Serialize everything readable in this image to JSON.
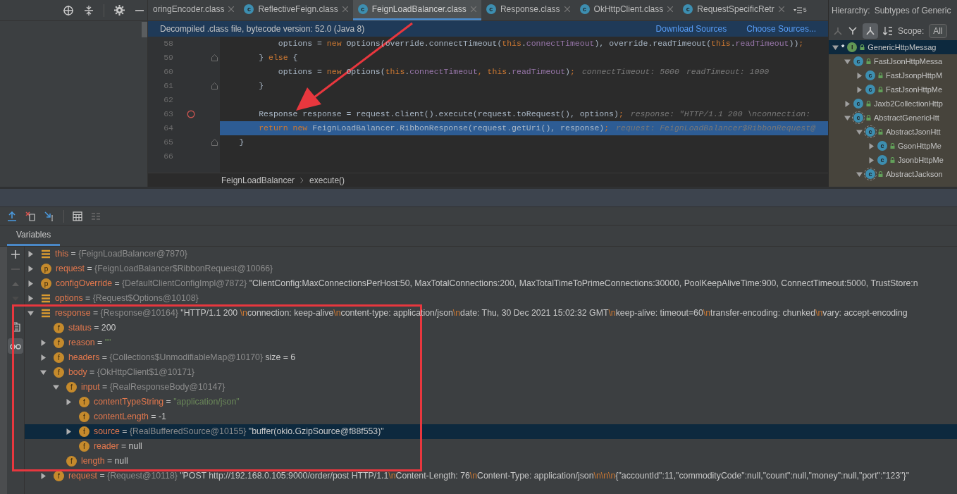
{
  "editor_tabs": [
    {
      "label": "oringEncoder.class",
      "selected": false
    },
    {
      "label": "ReflectiveFeign.class",
      "badge": "c",
      "selected": false
    },
    {
      "label": "FeignLoadBalancer.class",
      "badge": "c",
      "selected": true
    },
    {
      "label": "Response.class",
      "badge": "c",
      "selected": false
    },
    {
      "label": "OkHttpClient.class",
      "badge": "c",
      "selected": false
    },
    {
      "label": "RequestSpecificRetr",
      "badge": "c",
      "selected": false
    }
  ],
  "tab_overflow": "5",
  "banner": {
    "text": "Decompiled .class file, bytecode version: 52.0 (Java 8)",
    "links": [
      "Download Sources",
      "Choose Sources..."
    ]
  },
  "code_lines": [
    {
      "number": "58",
      "breakpoint": false,
      "current": false,
      "fold": false,
      "segments": [
        {
          "kind": "plain",
          "text": "            options = "
        },
        {
          "kind": "keyword",
          "text": "new"
        },
        {
          "kind": "plain",
          "text": " Options(override.connectTimeout("
        },
        {
          "kind": "keyword",
          "text": "this"
        },
        {
          "kind": "plain",
          "text": "."
        },
        {
          "kind": "field",
          "text": "connectTimeout"
        },
        {
          "kind": "plain",
          "text": "), override.readTimeout("
        },
        {
          "kind": "keyword",
          "text": "this"
        },
        {
          "kind": "plain",
          "text": "."
        },
        {
          "kind": "field",
          "text": "readTimeout"
        },
        {
          "kind": "plain",
          "text": "))"
        },
        {
          "kind": "keyword",
          "text": ";"
        }
      ]
    },
    {
      "number": "59",
      "breakpoint": false,
      "current": false,
      "fold": true,
      "segments": [
        {
          "kind": "plain",
          "text": "        } "
        },
        {
          "kind": "keyword",
          "text": "else"
        },
        {
          "kind": "plain",
          "text": " {"
        }
      ]
    },
    {
      "number": "60",
      "breakpoint": false,
      "current": false,
      "fold": false,
      "segments": [
        {
          "kind": "plain",
          "text": "            options = "
        },
        {
          "kind": "keyword",
          "text": "new"
        },
        {
          "kind": "plain",
          "text": " Options("
        },
        {
          "kind": "keyword",
          "text": "this"
        },
        {
          "kind": "plain",
          "text": "."
        },
        {
          "kind": "field",
          "text": "connectTimeout"
        },
        {
          "kind": "keyword",
          "text": ", this"
        },
        {
          "kind": "plain",
          "text": "."
        },
        {
          "kind": "field",
          "text": "readTimeout"
        },
        {
          "kind": "plain",
          "text": ")"
        },
        {
          "kind": "keyword",
          "text": ";"
        },
        {
          "kind": "hint",
          "text": "connectTimeout: 5000"
        },
        {
          "kind": "hint",
          "text": "readTimeout: 1000"
        }
      ]
    },
    {
      "number": "61",
      "breakpoint": false,
      "current": false,
      "fold": true,
      "segments": [
        {
          "kind": "plain",
          "text": "        }"
        }
      ]
    },
    {
      "number": "62",
      "breakpoint": false,
      "current": false,
      "fold": false
    },
    {
      "number": "63",
      "breakpoint": true,
      "current": false,
      "fold": false,
      "segments": [
        {
          "kind": "plain",
          "text": "        Response response = request.client().execute(request.toRequest(), options)"
        },
        {
          "kind": "keyword",
          "text": ";"
        },
        {
          "kind": "hint",
          "text": "response: \"HTTP/1.1 200 \\nconnection: "
        }
      ]
    },
    {
      "number": "64",
      "breakpoint": false,
      "current": true,
      "fold": false,
      "segments": [
        {
          "kind": "keyword",
          "text": "        return new"
        },
        {
          "kind": "plain",
          "text": " FeignLoadBalancer.RibbonResponse(request.getUri(), response)"
        },
        {
          "kind": "keyword",
          "text": ";"
        },
        {
          "kind": "hint",
          "text": "request: FeignLoadBalancer$RibbonRequest@"
        }
      ]
    },
    {
      "number": "65",
      "breakpoint": false,
      "current": false,
      "fold": true,
      "segments": [
        {
          "kind": "plain",
          "text": "    }"
        }
      ]
    },
    {
      "number": "66",
      "breakpoint": false,
      "current": false,
      "fold": false
    }
  ],
  "breadcrumb": [
    "FeignLoadBalancer",
    "execute()"
  ],
  "hierarchy": {
    "title": "Hierarchy:",
    "subtitle": "Subtypes of Generic",
    "scope_label": "Scope:",
    "scope_value": "All",
    "tree": [
      {
        "marker": "*",
        "kind": "interface",
        "badge": "I",
        "name": "GenericHttpMessag",
        "expanded": true,
        "selected": true,
        "children": [
          {
            "kind": "class",
            "badge": "c",
            "name": "FastJsonHttpMessa",
            "expanded": true,
            "selected": false,
            "children": [
              {
                "kind": "class",
                "badge": "c",
                "name": "FastJsonpHttpM",
                "expanded": false,
                "selected": false
              },
              {
                "kind": "class",
                "badge": "c",
                "name": "FastJsonHttpMe",
                "expanded": false,
                "selected": false
              }
            ]
          },
          {
            "kind": "class",
            "badge": "c",
            "name": "Jaxb2CollectionHttp",
            "expanded": false,
            "selected": false
          },
          {
            "kind": "abstract",
            "badge": "c",
            "name": "AbstractGenericHtt",
            "expanded": true,
            "selected": false,
            "children": [
              {
                "kind": "abstract",
                "badge": "c",
                "name": "AbstractJsonHtt",
                "expanded": true,
                "selected": false,
                "children": [
                  {
                    "kind": "class",
                    "badge": "c",
                    "name": "GsonHttpMe",
                    "expanded": false,
                    "selected": false
                  },
                  {
                    "kind": "class",
                    "badge": "c",
                    "name": "JsonbHttpMe",
                    "expanded": false,
                    "selected": false
                  }
                ]
              },
              {
                "kind": "abstract",
                "badge": "c",
                "name": "AbstractJackson",
                "expanded": true,
                "selected": false
              }
            ]
          }
        ]
      }
    ]
  },
  "debugger": {
    "tab": "Variables",
    "variables": [
      {
        "kind": "local",
        "expanded": false,
        "selected": false,
        "segments": [
          {
            "kind": "name",
            "text": "this"
          },
          {
            "kind": "text",
            "text": " = "
          },
          {
            "kind": "ref",
            "text": "{FeignLoadBalancer@7870}"
          }
        ]
      },
      {
        "kind": "badge",
        "badge": "p",
        "expanded": false,
        "selected": false,
        "segments": [
          {
            "kind": "name",
            "text": "request"
          },
          {
            "kind": "text",
            "text": " = "
          },
          {
            "kind": "ref",
            "text": "{FeignLoadBalancer$RibbonRequest@10066}"
          }
        ]
      },
      {
        "kind": "badge",
        "badge": "p",
        "expanded": false,
        "selected": false,
        "segments": [
          {
            "kind": "name",
            "text": "configOverride"
          },
          {
            "kind": "text",
            "text": " = "
          },
          {
            "kind": "ref",
            "text": "{DefaultClientConfigImpl@7872}"
          },
          {
            "kind": "text",
            "text": " \"ClientConfig:MaxConnectionsPerHost:50, MaxTotalConnections:200, MaxTotalTimeToPrimeConnections:30000, PoolKeepAliveTime:900, ConnectTimeout:5000, TrustStore:n"
          }
        ]
      },
      {
        "kind": "local",
        "expanded": false,
        "selected": false,
        "segments": [
          {
            "kind": "name",
            "text": "options"
          },
          {
            "kind": "text",
            "text": " = "
          },
          {
            "kind": "ref",
            "text": "{Request$Options@10108}"
          }
        ]
      },
      {
        "kind": "local",
        "expanded": true,
        "selected": false,
        "segments": [
          {
            "kind": "name",
            "text": "response"
          },
          {
            "kind": "text",
            "text": " = "
          },
          {
            "kind": "ref",
            "text": "{Response@10164}"
          },
          {
            "kind": "text",
            "text": " \"HTTP/1.1 200 "
          },
          {
            "kind": "escape",
            "text": "\\n"
          },
          {
            "kind": "text",
            "text": "connection: keep-alive"
          },
          {
            "kind": "escape",
            "text": "\\n"
          },
          {
            "kind": "text",
            "text": "content-type: application/json"
          },
          {
            "kind": "escape",
            "text": "\\n"
          },
          {
            "kind": "text",
            "text": "date: Thu, 30 Dec 2021 15:02:32 GMT"
          },
          {
            "kind": "escape",
            "text": "\\n"
          },
          {
            "kind": "text",
            "text": "keep-alive: timeout=60"
          },
          {
            "kind": "escape",
            "text": "\\n"
          },
          {
            "kind": "text",
            "text": "transfer-encoding: chunked"
          },
          {
            "kind": "escape",
            "text": "\\n"
          },
          {
            "kind": "text",
            "text": "vary: accept-encoding"
          }
        ],
        "children": [
          {
            "kind": "badge",
            "badge": "f",
            "selected": false,
            "segments": [
              {
                "kind": "name",
                "text": "status"
              },
              {
                "kind": "text",
                "text": " = 200"
              }
            ]
          },
          {
            "kind": "badge",
            "badge": "f",
            "expanded": false,
            "selected": false,
            "segments": [
              {
                "kind": "name",
                "text": "reason"
              },
              {
                "kind": "text",
                "text": " = "
              },
              {
                "kind": "string",
                "text": "\"\""
              }
            ]
          },
          {
            "kind": "badge",
            "badge": "f",
            "expanded": false,
            "selected": false,
            "segments": [
              {
                "kind": "name",
                "text": "headers"
              },
              {
                "kind": "text",
                "text": " = "
              },
              {
                "kind": "ref",
                "text": "{Collections$UnmodifiableMap@10170}"
              },
              {
                "kind": "text",
                "text": "  size = 6"
              }
            ]
          },
          {
            "kind": "badge",
            "badge": "f",
            "expanded": true,
            "selected": false,
            "segments": [
              {
                "kind": "name",
                "text": "body"
              },
              {
                "kind": "text",
                "text": " = "
              },
              {
                "kind": "ref",
                "text": "{OkHttpClient$1@10171}"
              }
            ],
            "children": [
              {
                "kind": "badge",
                "badge": "f",
                "expanded": true,
                "selected": false,
                "segments": [
                  {
                    "kind": "name",
                    "text": "input"
                  },
                  {
                    "kind": "text",
                    "text": " = "
                  },
                  {
                    "kind": "ref",
                    "text": "{RealResponseBody@10147}"
                  }
                ],
                "children": [
                  {
                    "kind": "badge",
                    "badge": "f",
                    "expanded": false,
                    "selected": false,
                    "segments": [
                      {
                        "kind": "name",
                        "text": "contentTypeString"
                      },
                      {
                        "kind": "text",
                        "text": " = "
                      },
                      {
                        "kind": "string",
                        "text": "\"application/json\""
                      }
                    ]
                  },
                  {
                    "kind": "badge",
                    "badge": "f",
                    "selected": false,
                    "segments": [
                      {
                        "kind": "name",
                        "text": "contentLength"
                      },
                      {
                        "kind": "text",
                        "text": " = -1"
                      }
                    ]
                  },
                  {
                    "kind": "badge",
                    "badge": "f",
                    "expanded": false,
                    "selected": true,
                    "segments": [
                      {
                        "kind": "name",
                        "text": "source"
                      },
                      {
                        "kind": "text",
                        "text": " = "
                      },
                      {
                        "kind": "ref",
                        "text": "{RealBufferedSource@10155}"
                      },
                      {
                        "kind": "text",
                        "text": " \"buffer(okio.GzipSource@f88f553)\""
                      }
                    ]
                  },
                  {
                    "kind": "badge",
                    "badge": "f",
                    "selected": false,
                    "segments": [
                      {
                        "kind": "name",
                        "text": "reader"
                      },
                      {
                        "kind": "text",
                        "text": " = null"
                      }
                    ]
                  }
                ]
              },
              {
                "kind": "badge",
                "badge": "f",
                "selected": false,
                "segments": [
                  {
                    "kind": "name",
                    "text": "length"
                  },
                  {
                    "kind": "text",
                    "text": " = null"
                  }
                ]
              }
            ]
          },
          {
            "kind": "badge",
            "badge": "f",
            "expanded": false,
            "selected": false,
            "segments": [
              {
                "kind": "name",
                "text": "request"
              },
              {
                "kind": "text",
                "text": " = "
              },
              {
                "kind": "ref",
                "text": "{Request@10118}"
              },
              {
                "kind": "text",
                "text": " \"POST http://192.168.0.105:9000/order/post HTTP/1.1"
              },
              {
                "kind": "escape",
                "text": "\\n"
              },
              {
                "kind": "text",
                "text": "Content-Length: 76"
              },
              {
                "kind": "escape",
                "text": "\\n"
              },
              {
                "kind": "text",
                "text": "Content-Type: application/json"
              },
              {
                "kind": "escape",
                "text": "\\n\\n\\n"
              },
              {
                "kind": "text",
                "text": "{\"accountId\":11,\"commodityCode\":null,\"count\":null,\"money\":null,\"port\":\"123\"}\""
              }
            ]
          }
        ]
      }
    ]
  }
}
